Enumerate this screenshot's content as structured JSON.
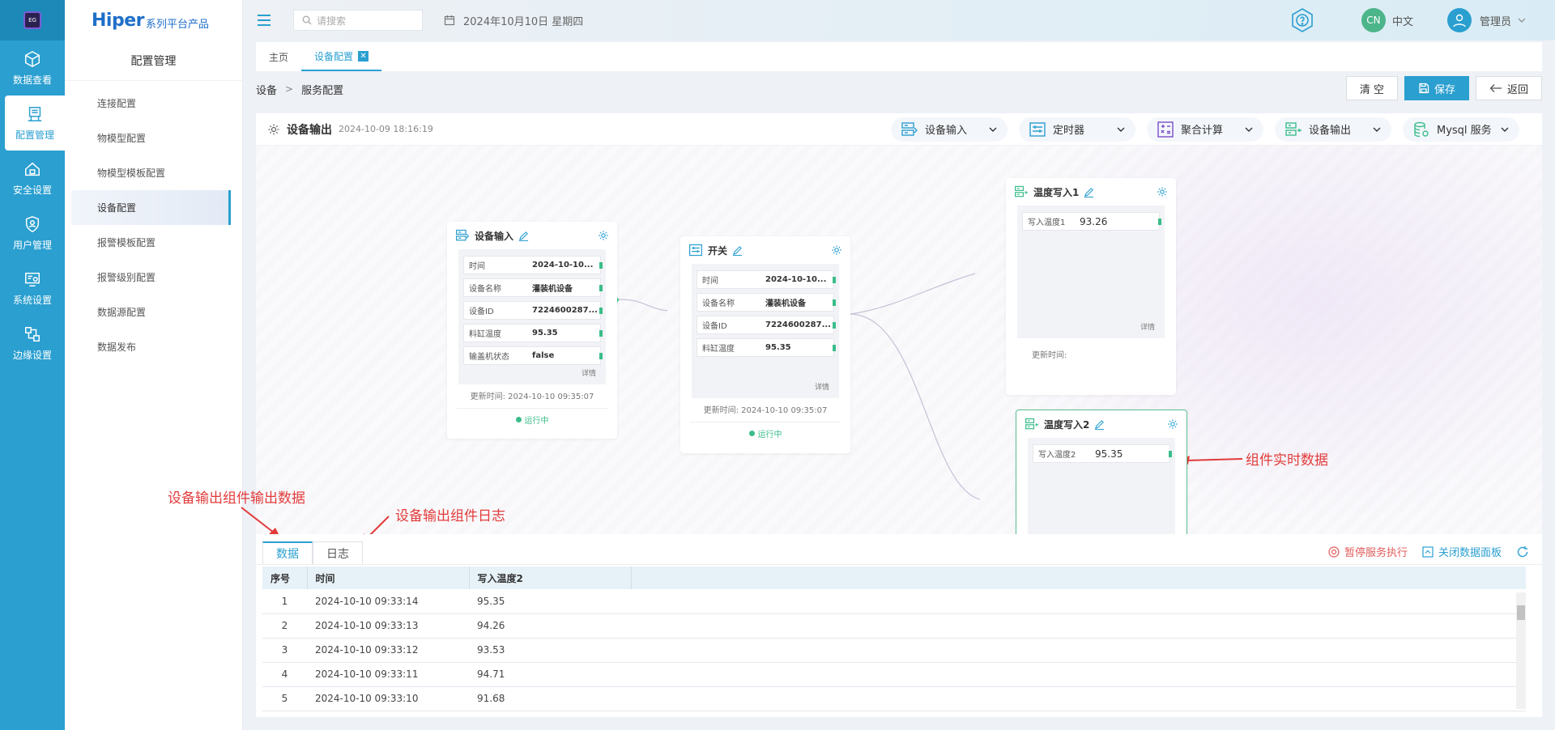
{
  "rail": {
    "items": [
      {
        "label": "数据查看",
        "icon": "cube-icon"
      },
      {
        "label": "配置管理",
        "icon": "config-icon",
        "active": true
      },
      {
        "label": "安全设置",
        "icon": "security-icon"
      },
      {
        "label": "用户管理",
        "icon": "shield-user-icon"
      },
      {
        "label": "系统设置",
        "icon": "system-icon"
      },
      {
        "label": "边缘设置",
        "icon": "edge-icon"
      }
    ]
  },
  "brand": {
    "name": "Hiper",
    "suffix": "系列平台产品"
  },
  "subnav": {
    "title": "配置管理",
    "items": [
      {
        "label": "连接配置"
      },
      {
        "label": "物模型配置"
      },
      {
        "label": "物模型模板配置"
      },
      {
        "label": "设备配置",
        "active": true
      },
      {
        "label": "报警模板配置"
      },
      {
        "label": "报警级别配置"
      },
      {
        "label": "数据源配置"
      },
      {
        "label": "数据发布"
      }
    ]
  },
  "header": {
    "search_placeholder": "请搜索",
    "date": "2024年10月10日 星期四",
    "lang_badge": "CN",
    "lang": "中文",
    "user": "管理员"
  },
  "tabs": [
    {
      "label": "主页"
    },
    {
      "label": "设备配置",
      "active": true
    }
  ],
  "breadcrumb": {
    "root": "设备",
    "sep": ">",
    "current": "服务配置"
  },
  "actions": {
    "clear": "清 空",
    "save": "保存",
    "back": "返回"
  },
  "panel": {
    "title": "设备输出",
    "time": "2024-10-09 18:16:19",
    "tools": [
      {
        "label": "设备输入",
        "icon": "device-input-icon"
      },
      {
        "label": "定时器",
        "icon": "timer-icon"
      },
      {
        "label": "聚合计算",
        "icon": "calculator-icon"
      },
      {
        "label": "设备输出",
        "icon": "device-output-icon"
      },
      {
        "label": "Mysql 服务",
        "icon": "database-icon"
      }
    ]
  },
  "nodes": {
    "input": {
      "title": "设备输入",
      "fields": [
        {
          "k": "时间",
          "v": "2024-10-10..."
        },
        {
          "k": "设备名称",
          "v": "灌装机设备"
        },
        {
          "k": "设备ID",
          "v": "7224600287..."
        },
        {
          "k": "料缸温度",
          "v": "95.35"
        },
        {
          "k": "输盖机状态",
          "v": "false"
        }
      ],
      "more": "详情",
      "updated": "更新时间: 2024-10-10 09:35:07",
      "status": "运行中"
    },
    "switch": {
      "title": "开关",
      "fields": [
        {
          "k": "时间",
          "v": "2024-10-10..."
        },
        {
          "k": "设备名称",
          "v": "灌装机设备"
        },
        {
          "k": "设备ID",
          "v": "7224600287..."
        },
        {
          "k": "料缸温度",
          "v": "95.35"
        }
      ],
      "more": "详情",
      "updated": "更新时间: 2024-10-10 09:35:07",
      "status": "运行中"
    },
    "write1": {
      "title": "温度写入1",
      "fields": [
        {
          "k": "写入温度1",
          "v": "93.26"
        }
      ],
      "more": "详情",
      "updated": "更新时间:"
    },
    "write2": {
      "title": "温度写入2",
      "fields": [
        {
          "k": "写入温度2",
          "v": "95.35"
        }
      ]
    }
  },
  "annotations": {
    "realtime": "组件实时数据",
    "output_data": "设备输出组件输出数据",
    "output_log": "设备输出组件日志"
  },
  "data_panel": {
    "tabs": [
      {
        "label": "数据",
        "active": true
      },
      {
        "label": "日志"
      }
    ],
    "pause": "暂停服务执行",
    "close": "关闭数据面板",
    "columns": [
      "序号",
      "时间",
      "写入温度2"
    ],
    "rows": [
      [
        "1",
        "2024-10-10 09:33:14",
        "95.35"
      ],
      [
        "2",
        "2024-10-10 09:33:13",
        "94.26"
      ],
      [
        "3",
        "2024-10-10 09:33:12",
        "93.53"
      ],
      [
        "4",
        "2024-10-10 09:33:11",
        "94.71"
      ],
      [
        "5",
        "2024-10-10 09:33:10",
        "91.68"
      ]
    ]
  },
  "colors": {
    "accent": "#2a9fd0",
    "ok": "#3bbd8a",
    "annotation": "#e23b3b"
  }
}
